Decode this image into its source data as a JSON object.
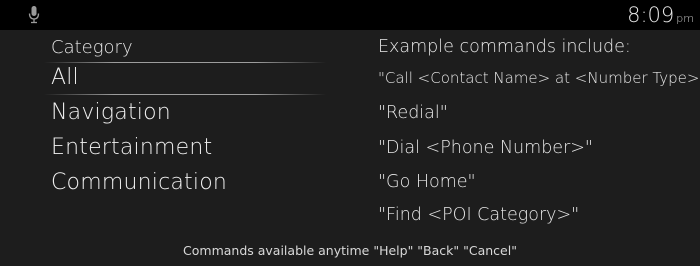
{
  "status_bar": {
    "mic_icon": "microphone-icon",
    "time": "8:09",
    "ampm": "pm"
  },
  "categories": {
    "title": "Category",
    "items": [
      {
        "label": "All",
        "selected": true
      },
      {
        "label": "Navigation",
        "selected": false
      },
      {
        "label": "Entertainment",
        "selected": false
      },
      {
        "label": "Communication",
        "selected": false
      }
    ]
  },
  "examples": {
    "title": "Example commands include:",
    "commands": [
      "\"Call <Contact Name> at <Number Type>\"",
      "\"Redial\"",
      "\"Dial <Phone Number>\"",
      "\"Go Home\"",
      "\"Find <POI Category>\""
    ]
  },
  "footer": {
    "text": "Commands available anytime \"Help\" \"Back\" \"Cancel\""
  }
}
